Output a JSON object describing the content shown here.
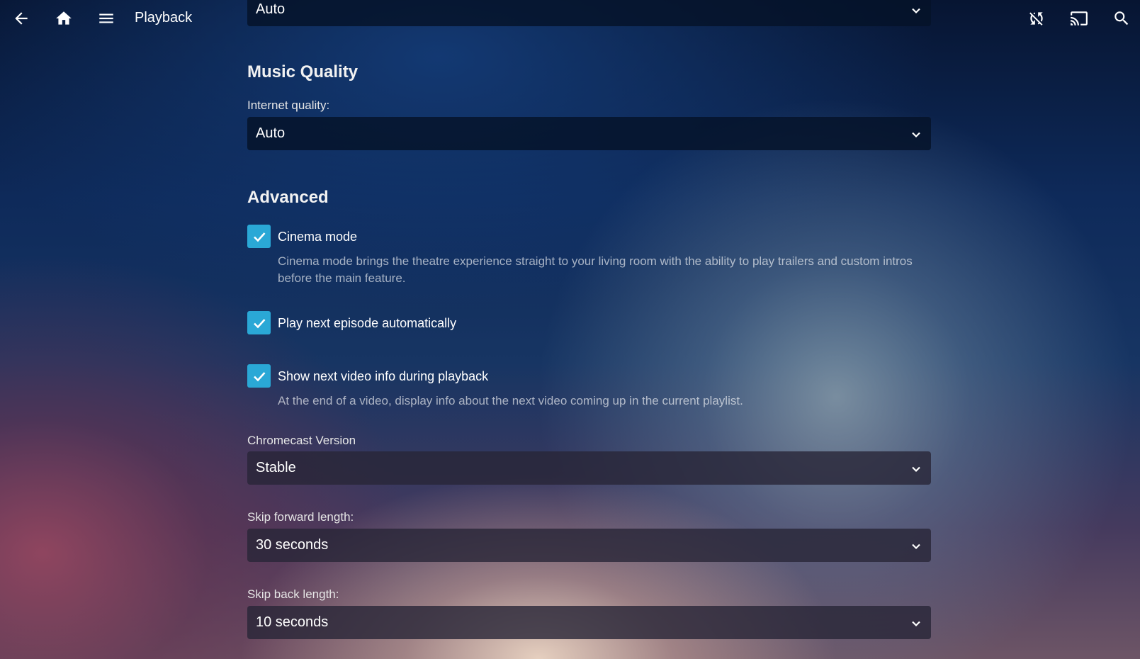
{
  "header": {
    "title": "Playback",
    "icons": [
      "back-arrow-icon",
      "home-icon",
      "menu-icon",
      "sync-off-icon",
      "cast-icon",
      "search-icon"
    ]
  },
  "video_quality": {
    "selected": "Auto"
  },
  "music_quality": {
    "heading": "Music Quality",
    "internet_label": "Internet quality:",
    "internet_selected": "Auto"
  },
  "advanced": {
    "heading": "Advanced",
    "cinema_mode": {
      "label": "Cinema mode",
      "checked": true,
      "description": "Cinema mode brings the theatre experience straight to your living room with the ability to play trailers and custom intros before the main feature."
    },
    "play_next": {
      "label": "Play next episode automatically",
      "checked": true
    },
    "show_next_info": {
      "label": "Show next video info during playback",
      "checked": true,
      "description": "At the end of a video, display info about the next video coming up in the current playlist."
    },
    "chromecast": {
      "label": "Chromecast Version",
      "selected": "Stable"
    },
    "skip_forward": {
      "label": "Skip forward length:",
      "selected": "30 seconds"
    },
    "skip_back": {
      "label": "Skip back length:",
      "selected": "10 seconds"
    }
  },
  "colors": {
    "accent": "#2aa8d6"
  }
}
